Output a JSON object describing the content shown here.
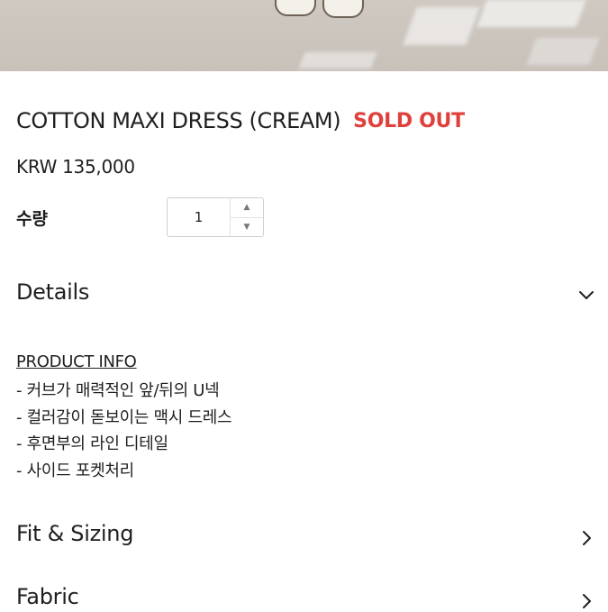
{
  "product": {
    "title": "COTTON MAXI DRESS (CREAM)",
    "status": "SOLD OUT",
    "price": "KRW 135,000"
  },
  "quantity": {
    "label": "수량",
    "value": "1"
  },
  "details": {
    "title": "Details",
    "info_heading": "PRODUCT INFO",
    "info_items": [
      "- 커브가 매력적인 앞/뒤의 U넥",
      "- 컬러감이 돋보이는 맥시 드레스",
      "- 후면부의 라인 디테일",
      "- 사이드 포켓처리"
    ]
  },
  "fit_sizing": {
    "title": "Fit & Sizing"
  },
  "fabric": {
    "title": "Fabric"
  },
  "colors": {
    "sold_out": "#e0403b",
    "text": "#1f1f1f"
  },
  "icons": {
    "details": "chevron-down-icon",
    "fit_sizing": "chevron-right-icon",
    "fabric": "chevron-right-icon",
    "step_up": "caret-up-icon",
    "step_down": "caret-down-icon"
  }
}
